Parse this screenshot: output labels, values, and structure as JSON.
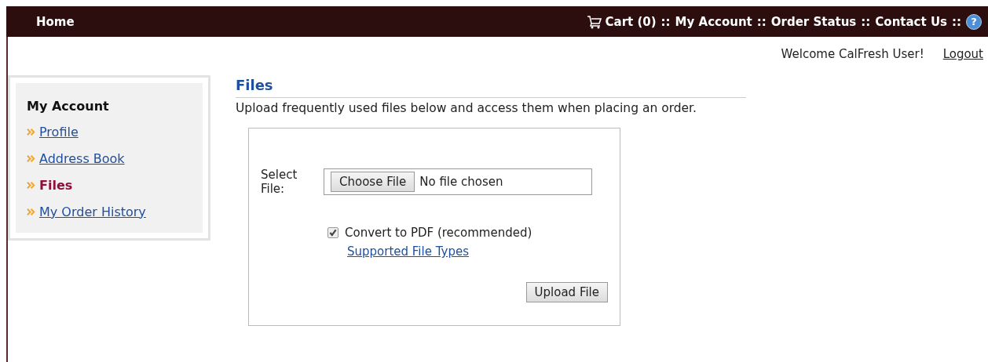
{
  "top_bar": {
    "home": "Home",
    "nav": [
      {
        "kind": "cart",
        "label": "Cart (0)"
      },
      {
        "kind": "separator",
        "label": "::"
      },
      {
        "kind": "link",
        "label": "My Account"
      },
      {
        "kind": "separator",
        "label": "::"
      },
      {
        "kind": "link",
        "label": "Order Status"
      },
      {
        "kind": "separator",
        "label": "::"
      },
      {
        "kind": "link",
        "label": "Contact Us"
      },
      {
        "kind": "separator",
        "label": "::"
      }
    ],
    "help_icon": "?"
  },
  "welcome": {
    "text": "Welcome CalFresh User!",
    "logout": "Logout"
  },
  "sidebar": {
    "heading": "My Account",
    "items": [
      {
        "label": "Profile",
        "selected": false
      },
      {
        "label": "Address Book",
        "selected": false
      },
      {
        "label": "Files",
        "selected": true
      },
      {
        "label": "My Order History",
        "selected": false
      }
    ]
  },
  "main": {
    "title": "Files",
    "description": "Upload frequently used files below and access them when placing an order.",
    "form": {
      "select_label": "Select File:",
      "choose_button": "Choose File",
      "file_status": "No file chosen",
      "convert": {
        "label": "Convert to PDF (recommended)",
        "checked": true
      },
      "supported_link": "Supported File Types",
      "upload_button": "Upload File"
    }
  }
}
